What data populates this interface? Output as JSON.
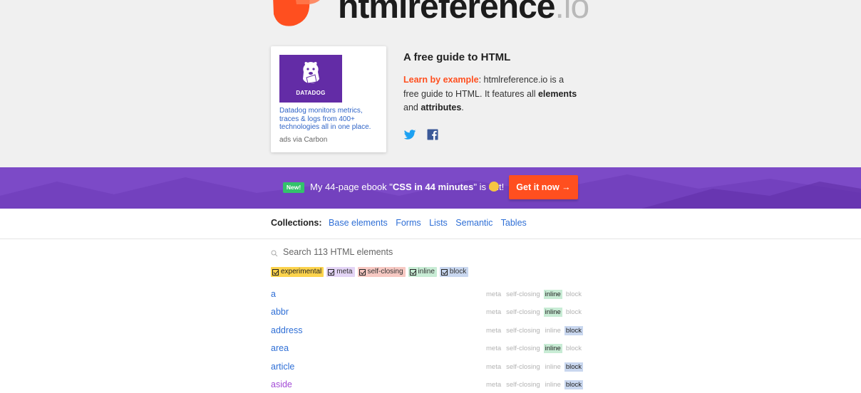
{
  "logo": {
    "name": "htmlreference",
    "tld": ".io"
  },
  "ad": {
    "brand": "DATADOG",
    "text": "Datadog monitors metrics, traces & logs from 400+ technologies all in one place.",
    "via": "ads via Carbon"
  },
  "intro": {
    "title": "A free guide to HTML",
    "lead": "Learn by example",
    "body_1": ": htmlreference.io is a free guide to HTML. It features all ",
    "bold_1": "elements",
    "body_2": " and ",
    "bold_2": "attributes",
    "body_3": "."
  },
  "social": {
    "twitter_icon": "twitter-icon",
    "facebook_icon": "facebook-icon"
  },
  "banner": {
    "badge": "New!",
    "text_before": "My 44-page ebook \"",
    "text_bold": "CSS in 44 minutes",
    "text_after": "\" is out!",
    "cta": "Get it now →"
  },
  "collections": {
    "label": "Collections:",
    "items": [
      "Base elements",
      "Forms",
      "Lists",
      "Semantic",
      "Tables"
    ]
  },
  "search": {
    "placeholder": "Search 113 HTML elements"
  },
  "filters": [
    "experimental",
    "meta",
    "self-closing",
    "inline",
    "block"
  ],
  "tag_labels": {
    "meta": "meta",
    "self": "self-closing",
    "inline": "inline",
    "block": "block"
  },
  "elements": [
    {
      "name": "a",
      "active": "inline"
    },
    {
      "name": "abbr",
      "active": "inline"
    },
    {
      "name": "address",
      "active": "block"
    },
    {
      "name": "area",
      "active": "inline"
    },
    {
      "name": "article",
      "active": "block"
    },
    {
      "name": "aside",
      "active": "block"
    }
  ],
  "colors": {
    "accent": "#ff4f1f",
    "link": "#2f6fd6",
    "banner": "#7c4ac7"
  }
}
